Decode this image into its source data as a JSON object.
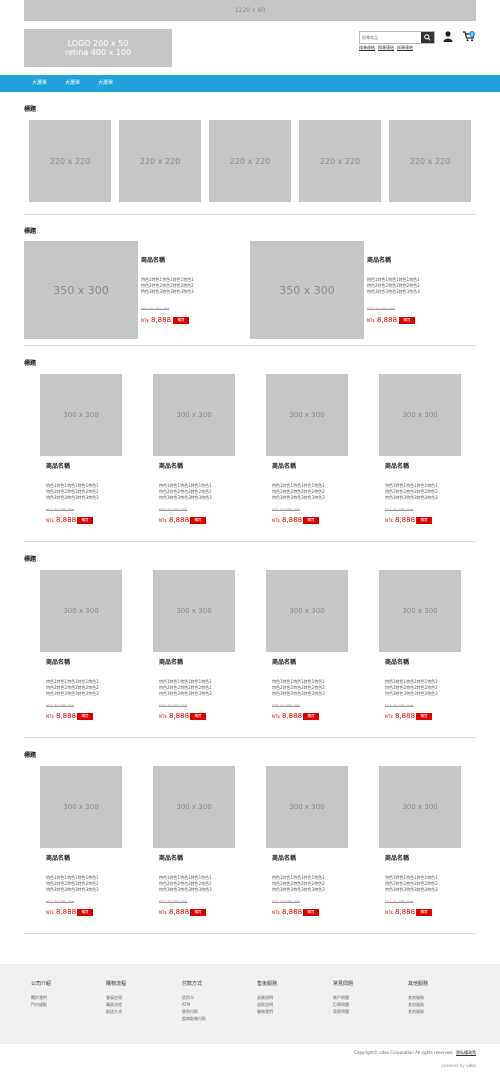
{
  "top_banner": "1220 x 60",
  "logo": {
    "line1": "LOGO 200 x 50",
    "line2": "retina 400 x 100"
  },
  "search": {
    "placeholder": "搜尋商品"
  },
  "quick_links": [
    "搜尋連結",
    "搜尋連結",
    "搜尋連結"
  ],
  "cart_count": "0",
  "nav": [
    "大選單",
    "大選單",
    "大選單"
  ],
  "sections": [
    {
      "title": "標題",
      "thumbs": [
        "220 x 220",
        "220 x 220",
        "220 x 220",
        "220 x 220",
        "220 x 220"
      ]
    },
    {
      "title": "標題",
      "featured": [
        {
          "img": "350 x 300",
          "name": "商品名稱",
          "desc": "特色1特色1特色1特色1特色1\n特色2特色2特色2特色2特色2\n特色3特色3特色3特色3特色3",
          "old": "NT$ 99,999,999",
          "cur": "NT$",
          "price": "8,888",
          "buy": "購買"
        },
        {
          "img": "350 x 300",
          "name": "商品名稱",
          "desc": "特色1特色1特色1特色1特色1\n特色2特色2特色2特色2特色2\n特色3特色3特色3特色3特色3",
          "old": "NT$ 99,999,999",
          "cur": "NT$",
          "price": "8,888",
          "buy": "購買"
        }
      ]
    },
    {
      "title": "標題"
    },
    {
      "title": "標題"
    },
    {
      "title": "標題"
    }
  ],
  "product": {
    "img": "300 x 300",
    "name": "商品名稱",
    "desc": "特色1特色1特色1特色1特色1\n特色2特色2特色2特色2特色2\n特色3特色3特色3特色3特色3",
    "old": "NT$ 99,999,999",
    "cur": "NT$",
    "price": "8,888",
    "buy": "購買"
  },
  "footer": {
    "columns": [
      {
        "title": "公司介紹",
        "links": [
          "關於我們",
          "門市據點"
        ]
      },
      {
        "title": "購物流程",
        "links": [
          "會員註冊",
          "購買流程",
          "配送方式"
        ]
      },
      {
        "title": "付款方式",
        "links": [
          "信用卡",
          "ATM",
          "貨到付款",
          "超商取貨付款"
        ]
      },
      {
        "title": "售後服務",
        "links": [
          "退貨說明",
          "退款說明",
          "聯絡我們"
        ]
      },
      {
        "title": "常見問題",
        "links": [
          "帳戶問題",
          "訂單問題",
          "發票問題"
        ]
      },
      {
        "title": "其他服務",
        "links": [
          "其他服務",
          "其他服務",
          "其他服務"
        ]
      }
    ],
    "copyright": "Copyright© uitox Corporation All rights reserved.",
    "privacy": "隱私權政策",
    "powered": "powered by",
    "powered_brand": "uitox"
  },
  "colors": {
    "accent": "#1fa2db",
    "price_red": "#dd0000",
    "placeholder_gray": "#c6c6c6"
  }
}
